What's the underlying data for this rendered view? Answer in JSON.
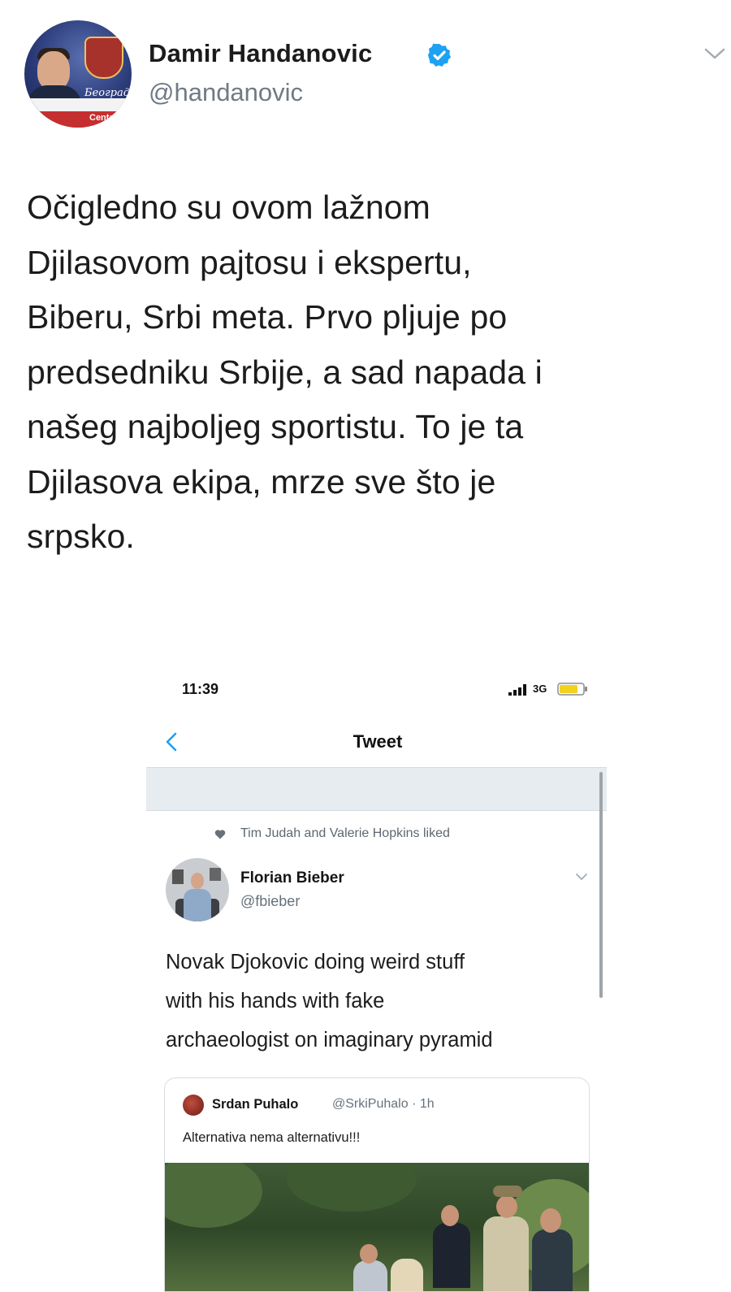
{
  "author": {
    "name": "Damir Handanovic",
    "handle": "@handanovic",
    "avatar_text": "Београд",
    "avatar_logo": "Centar",
    "verified_icon": "verified-badge-icon"
  },
  "tweet": {
    "text": "Očigledno su ovom lažnom\nDjilasovom pajtosu i ekspertu,\nBiberu, Srbi meta. Prvo pljuje po\npredsedniku Srbije, a sad napada i\nnašeg najboljeg sportistu. To je ta\nDjilasova ekipa, mrze sve što je\nsrpsko."
  },
  "embedded_screenshot": {
    "status_time": "11:39",
    "network": "3G",
    "nav_title": "Tweet",
    "liked_by": "Tim Judah and Valerie Hopkins liked",
    "inner_tweet": {
      "name": "Florian Bieber",
      "handle": "@fbieber",
      "text": "Novak Djokovic doing weird stuff\nwith his hands with fake\narchaeologist on imaginary pyramid"
    },
    "quoted_tweet": {
      "name": "Srdan Puhalo",
      "handle_time": "@SrkiPuhalo · 1h",
      "text": "Alternativa nema alternativu!!!"
    }
  },
  "colors": {
    "verified_blue": "#1da1f2",
    "link_blue": "#1da1f2",
    "secondary_text": "#707a84",
    "separator": "#e6ecf0"
  }
}
